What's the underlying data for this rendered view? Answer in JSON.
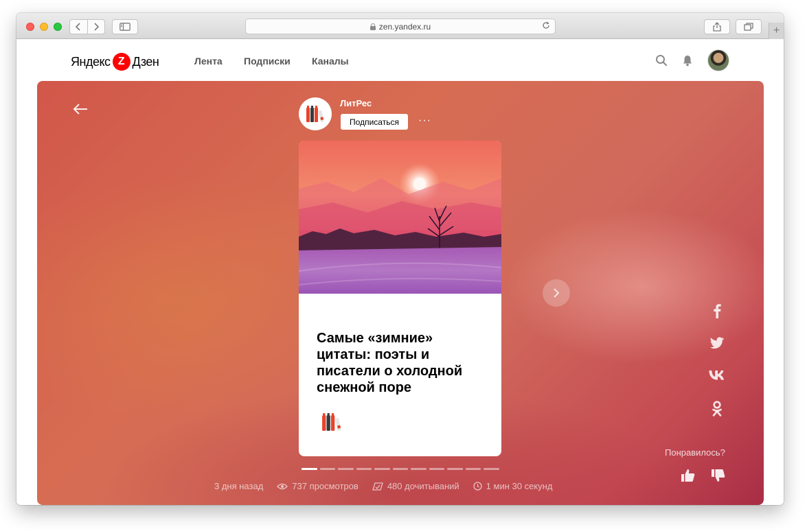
{
  "browser": {
    "url": "zen.yandex.ru"
  },
  "header": {
    "logo_left": "Яндекс",
    "logo_badge": "Z",
    "logo_right": "Дзен",
    "menu": [
      {
        "label": "Лента"
      },
      {
        "label": "Подписки"
      },
      {
        "label": "Каналы"
      }
    ]
  },
  "channel": {
    "name": "ЛитРес",
    "subscribe_label": "Подписаться",
    "more_label": "···"
  },
  "card": {
    "title": "Самые «зимние» цитаты: поэты и писатели о холодной снежной поре"
  },
  "progress": {
    "total_slides": 11,
    "current_slide": 1
  },
  "stats": {
    "date": "3 дня назад",
    "views": "737 просмотров",
    "reads": "480 дочитываний",
    "read_time": "1 мин 30 секунд"
  },
  "feedback": {
    "question": "Понравилось?"
  },
  "colors": {
    "accent": "#ff0000",
    "stage_base": "#d1574a"
  }
}
